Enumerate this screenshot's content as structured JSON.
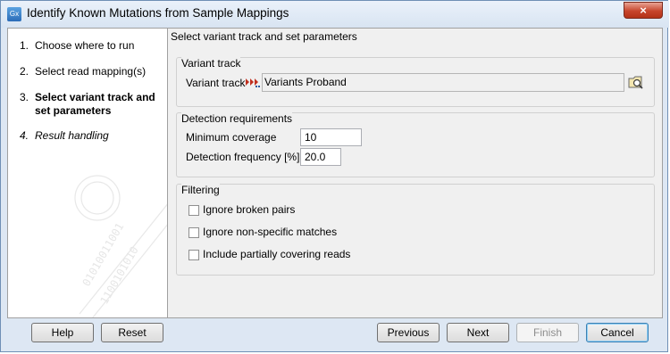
{
  "window": {
    "title": "Identify Known Mutations from Sample Mappings",
    "app_icon_text": "Gx",
    "close_glyph": "×"
  },
  "steps": [
    {
      "num": "1.",
      "label": "Choose where to run"
    },
    {
      "num": "2.",
      "label": "Select read mapping(s)"
    },
    {
      "num": "3.",
      "label": "Select variant track and set parameters"
    },
    {
      "num": "4.",
      "label": "Result handling"
    }
  ],
  "content": {
    "title": "Select variant track and set parameters",
    "variant_group": {
      "title": "Variant track",
      "label": "Variant track",
      "value": "Variants Proband"
    },
    "detection_group": {
      "title": "Detection requirements",
      "min_coverage_label": "Minimum coverage",
      "min_coverage_value": "10",
      "freq_label": "Detection frequency [%]",
      "freq_value": "20.0"
    },
    "filtering_group": {
      "title": "Filtering",
      "options": [
        {
          "label": "Ignore broken pairs",
          "checked": false
        },
        {
          "label": "Ignore non-specific matches",
          "checked": false
        },
        {
          "label": "Include partially covering reads",
          "checked": false
        }
      ]
    }
  },
  "footer": {
    "help": "Help",
    "reset": "Reset",
    "previous": "Previous",
    "next": "Next",
    "finish": "Finish",
    "cancel": "Cancel"
  }
}
